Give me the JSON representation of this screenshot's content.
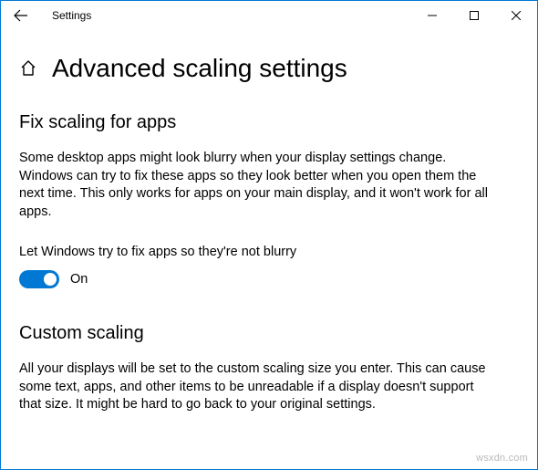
{
  "titlebar": {
    "title": "Settings"
  },
  "page": {
    "title": "Advanced scaling settings"
  },
  "section1": {
    "heading": "Fix scaling for apps",
    "description": "Some desktop apps might look blurry when your display settings change. Windows can try to fix these apps so they look better when you open them the next time. This only works for apps on your main display, and it won't work for all apps.",
    "toggleLabel": "Let Windows try to fix apps so they're not blurry",
    "toggleState": "On"
  },
  "section2": {
    "heading": "Custom scaling",
    "description": "All your displays will be set to the custom scaling size you enter. This can cause some text, apps, and other items to be unreadable if a display doesn't support that size. It might be hard to go back to your original settings."
  },
  "watermark": "wsxdn.com"
}
